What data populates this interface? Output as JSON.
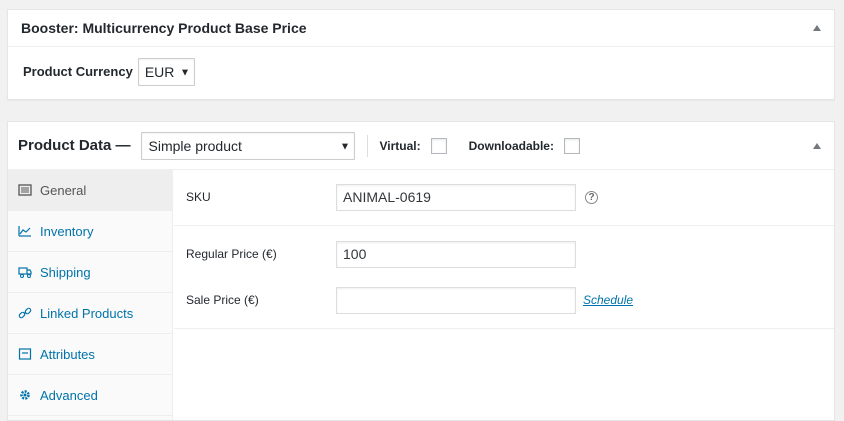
{
  "booster_box": {
    "title": "Booster: Multicurrency Product Base Price",
    "currency_label": "Product Currency",
    "currency_value": "EUR"
  },
  "product_data": {
    "title": "Product Data —",
    "product_type": "Simple product",
    "virtual_label": "Virtual:",
    "downloadable_label": "Downloadable:",
    "tabs": [
      {
        "label": "General",
        "icon": "general-icon"
      },
      {
        "label": "Inventory",
        "icon": "inventory-icon"
      },
      {
        "label": "Shipping",
        "icon": "shipping-icon"
      },
      {
        "label": "Linked Products",
        "icon": "link-icon"
      },
      {
        "label": "Attributes",
        "icon": "attributes-icon"
      },
      {
        "label": "Advanced",
        "icon": "gear-icon"
      }
    ],
    "general": {
      "sku_label": "SKU",
      "sku_value": "ANIMAL-0619",
      "help_glyph": "?",
      "regular_price_label": "Regular Price (€)",
      "regular_price_value": "100",
      "sale_price_label": "Sale Price (€)",
      "sale_price_value": "",
      "schedule_link": "Schedule"
    }
  },
  "colors": {
    "link": "#0073aa",
    "background": "#f1f1f1"
  }
}
